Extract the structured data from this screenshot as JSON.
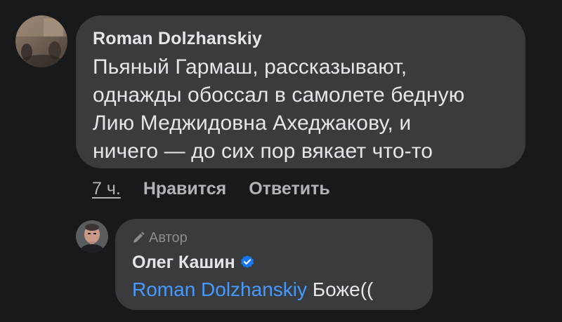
{
  "comment": {
    "author": "Roman Dolzhanskiy",
    "lines": [
      "Пьяный Гармаш, рассказывают,",
      "однажды обоссал в самолете бедную",
      "Лию Меджидовна Ахеджакову, и",
      "ничего — до сих пор вякает что-то"
    ],
    "time": "7 ч.",
    "like_label": "Нравится",
    "reply_label": "Ответить"
  },
  "reply": {
    "badge": "Автор",
    "author": "Олег Кашин",
    "mention": "Roman Dolzhanskiy",
    "text": "Боже(("
  },
  "colors": {
    "background": "#18191a",
    "bubble": "#3a3b3c",
    "mention": "#4599ff",
    "verified": "#1877f2"
  }
}
